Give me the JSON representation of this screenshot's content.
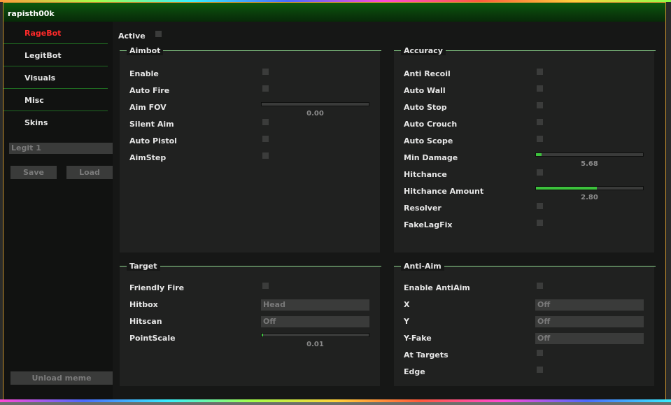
{
  "window": {
    "title": "rapisth00k"
  },
  "sidebar": {
    "tabs": [
      {
        "label": "RageBot",
        "active": true
      },
      {
        "label": "LegitBot",
        "active": false
      },
      {
        "label": "Visuals",
        "active": false
      },
      {
        "label": "Misc",
        "active": false
      },
      {
        "label": "Skins",
        "active": false
      }
    ],
    "config_value": "Legit 1",
    "save_label": "Save",
    "load_label": "Load",
    "unload_label": "Unload meme"
  },
  "main": {
    "active_label": "Active",
    "aimbot": {
      "title": "Aimbot",
      "enable": "Enable",
      "auto_fire": "Auto Fire",
      "aim_fov": "Aim FOV",
      "aim_fov_value": "0.00",
      "aim_fov_fraction": 0,
      "silent_aim": "Silent Aim",
      "auto_pistol": "Auto Pistol",
      "aimstep": "AimStep"
    },
    "accuracy": {
      "title": "Accuracy",
      "anti_recoil": "Anti Recoil",
      "auto_wall": "Auto Wall",
      "auto_stop": "Auto Stop",
      "auto_crouch": "Auto Crouch",
      "auto_scope": "Auto Scope",
      "min_damage": "Min Damage",
      "min_damage_value": "5.68",
      "min_damage_fraction": 0.05,
      "hitchance": "Hitchance",
      "hitchance_amount": "Hitchance Amount",
      "hitchance_amount_value": "2.80",
      "hitchance_amount_fraction": 0.57,
      "resolver": "Resolver",
      "fakelagfix": "FakeLagFix"
    },
    "target": {
      "title": "Target",
      "friendly_fire": "Friendly Fire",
      "hitbox": "Hitbox",
      "hitbox_value": "Head",
      "hitscan": "Hitscan",
      "hitscan_value": "Off",
      "pointscale": "PointScale",
      "pointscale_value": "0.01",
      "pointscale_fraction": 0.01
    },
    "antiaim": {
      "title": "Anti-Aim",
      "enable_antiaim": "Enable AntiAim",
      "x": "X",
      "x_value": "Off",
      "y": "Y",
      "y_value": "Off",
      "yfake": "Y-Fake",
      "yfake_value": "Off",
      "at_targets": "At Targets",
      "edge": "Edge"
    }
  }
}
